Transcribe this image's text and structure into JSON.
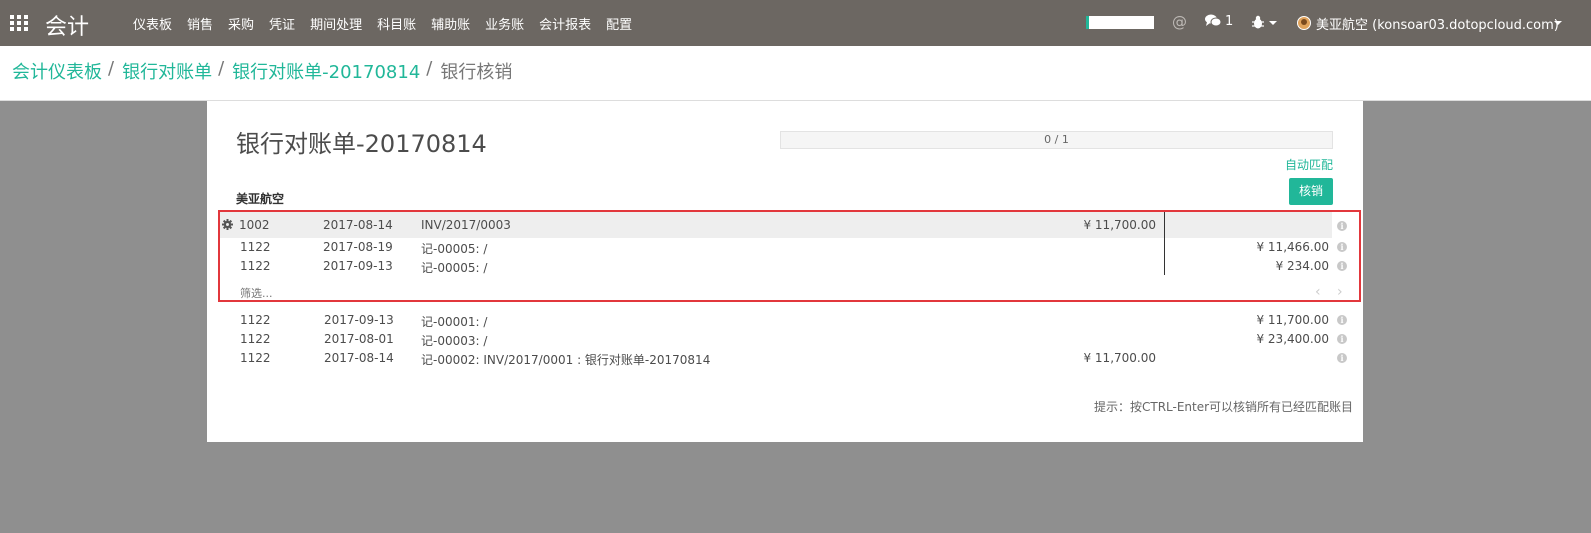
{
  "navbar": {
    "brand": "会计",
    "menu": [
      "仪表板",
      "销售",
      "采购",
      "凭证",
      "期间处理",
      "科目账",
      "辅助账",
      "业务账",
      "会计报表",
      "配置"
    ],
    "chat_count": "1",
    "user": "美亚航空 (konsoar03.dotopcloud.com)",
    "at_symbol": "@"
  },
  "breadcrumb": {
    "items": [
      "会计仪表板",
      "银行对账单",
      "银行对账单-20170814"
    ],
    "active": "银行核销",
    "separator": "/"
  },
  "sheet": {
    "title": "银行对账单-20170814",
    "progress_text": "0 / 1",
    "progress_fraction": 0,
    "auto_match": "自动匹配",
    "reconcile": "核销",
    "partner": "美亚航空",
    "statement_line": {
      "account": "1002",
      "date": "2017-08-14",
      "label": "INV/2017/0003",
      "amount": "¥ 11,700.00"
    },
    "matched_lines": [
      {
        "account": "1122",
        "date": "2017-08-19",
        "label": "记-00005: /",
        "debit": "",
        "credit": "¥ 11,466.00"
      },
      {
        "account": "1122",
        "date": "2017-09-13",
        "label": "记-00005: /",
        "debit": "",
        "credit": "¥ 234.00"
      }
    ],
    "filter_placeholder": "筛选...",
    "pager_prev": "‹",
    "pager_next": "›",
    "candidate_lines": [
      {
        "account": "1122",
        "date": "2017-09-13",
        "label": "记-00001: /",
        "debit": "",
        "credit": "¥ 11,700.00"
      },
      {
        "account": "1122",
        "date": "2017-08-01",
        "label": "记-00003: /",
        "debit": "",
        "credit": "¥ 23,400.00"
      },
      {
        "account": "1122",
        "date": "2017-08-14",
        "label": "记-00002: INV/2017/0001 : 银行对账单-20170814",
        "debit": "¥ 11,700.00",
        "credit": ""
      }
    ],
    "hint": "提示：按CTRL-Enter可以核销所有已经匹配账目"
  },
  "colors": {
    "accent": "#21b799",
    "navbar": "#6c6762",
    "highlight_border": "#e2373c"
  }
}
